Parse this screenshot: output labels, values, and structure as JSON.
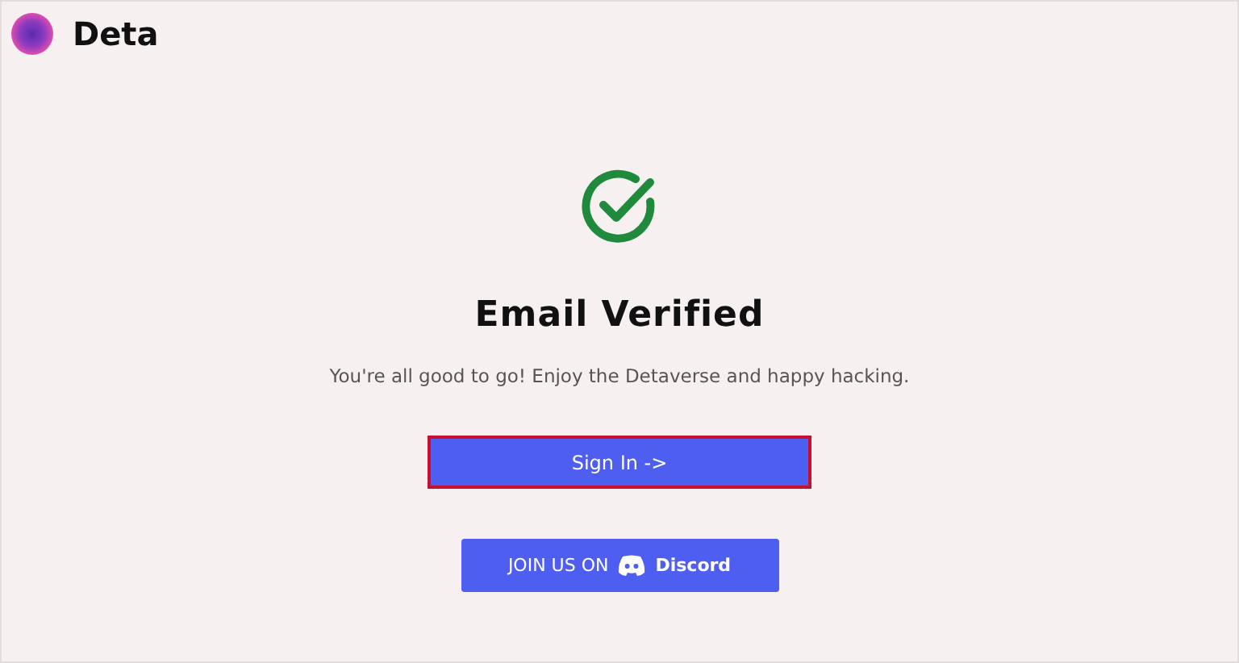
{
  "header": {
    "brand": "Deta"
  },
  "title": "Email Verified",
  "message": "You're all good to go! Enjoy the Detaverse and happy hacking.",
  "sign_in_button": {
    "label": "Sign In ->",
    "focused": true
  },
  "discord_button": {
    "label": "JOIN US ON",
    "brand": "Discord"
  }
}
